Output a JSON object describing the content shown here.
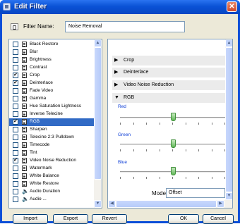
{
  "window": {
    "title": "Edit Filter",
    "close_glyph": "✕"
  },
  "filter_name": {
    "label": "Filter Name:",
    "value": "Noise Removal"
  },
  "filters": [
    {
      "label": "Black Restore",
      "checked": false,
      "icon": "film-icon"
    },
    {
      "label": "Blur",
      "checked": false,
      "icon": "film-icon"
    },
    {
      "label": "Brightness",
      "checked": false,
      "icon": "film-icon"
    },
    {
      "label": "Contrast",
      "checked": false,
      "icon": "film-icon"
    },
    {
      "label": "Crop",
      "checked": true,
      "icon": "film-icon"
    },
    {
      "label": "Deinterlace",
      "checked": true,
      "icon": "film-icon"
    },
    {
      "label": "Fade Video",
      "checked": false,
      "icon": "film-icon"
    },
    {
      "label": "Gamma",
      "checked": false,
      "icon": "film-icon"
    },
    {
      "label": "Hue Saturation Lightness",
      "checked": false,
      "icon": "film-icon"
    },
    {
      "label": "Inverse Telecine",
      "checked": false,
      "icon": "film-icon"
    },
    {
      "label": "RGB",
      "checked": true,
      "icon": "film-icon",
      "selected": true
    },
    {
      "label": "Sharpen",
      "checked": false,
      "icon": "film-icon"
    },
    {
      "label": "Telecine 2:3 Pulldown",
      "checked": false,
      "icon": "film-icon"
    },
    {
      "label": "Timecode",
      "checked": false,
      "icon": "film-icon"
    },
    {
      "label": "Tint",
      "checked": false,
      "icon": "film-icon"
    },
    {
      "label": "Video Noise Reduction",
      "checked": true,
      "icon": "film-icon"
    },
    {
      "label": "Watermark",
      "checked": false,
      "icon": "film-icon"
    },
    {
      "label": "White Balance",
      "checked": false,
      "icon": "film-icon"
    },
    {
      "label": "White Restore",
      "checked": false,
      "icon": "film-icon"
    },
    {
      "label": "Audio Duration",
      "checked": false,
      "icon": "speaker-icon"
    },
    {
      "label": "Audio ...",
      "checked": false,
      "icon": "speaker-icon"
    }
  ],
  "sections": [
    {
      "title": "Crop",
      "expanded": false
    },
    {
      "title": "Deinterlace",
      "expanded": false
    },
    {
      "title": "Video Noise Reduction",
      "expanded": false
    },
    {
      "title": "RGB",
      "expanded": true
    }
  ],
  "rgb": {
    "sliders": [
      {
        "label": "Red",
        "value": 0.5
      },
      {
        "label": "Green",
        "value": 0.5
      },
      {
        "label": "Blue",
        "value": 0.5
      }
    ],
    "mode_label": "Mode",
    "mode_value": "Offset"
  },
  "buttons": {
    "import": "Import",
    "export": "Export",
    "revert": "Revert",
    "ok": "OK",
    "cancel": "Cancel"
  },
  "glyphs": {
    "check": "✔",
    "arrow_right": "▶",
    "arrow_down": "▼",
    "scroll_up": "▲",
    "scroll_down": "▼",
    "scroll_left": "◀",
    "scroll_right": "▶",
    "speaker": "🔈"
  }
}
